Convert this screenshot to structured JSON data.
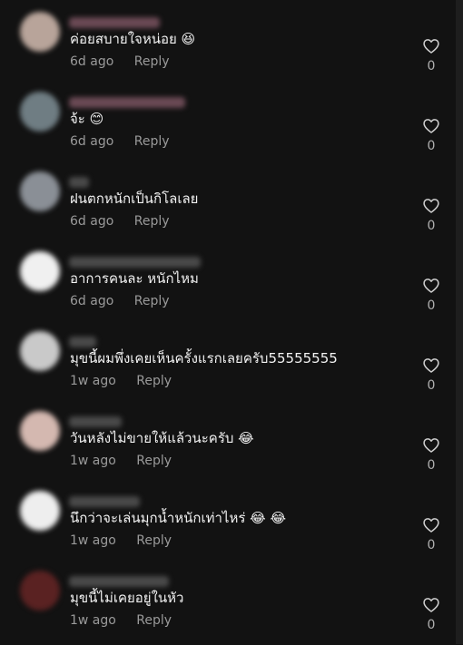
{
  "comments": [
    {
      "text": "ค่อยสบายใจหน่อย 😆",
      "time": "6d ago",
      "reply": "Reply",
      "likes": "0",
      "avatar_color": "#b8a49a",
      "username_width": 100
    },
    {
      "text": "จ้ะ 😊",
      "time": "6d ago",
      "reply": "Reply",
      "likes": "0",
      "avatar_color": "#6f7d83",
      "username_width": 128
    },
    {
      "text": "ฝนตกหนักเป็นกิโลเลย",
      "time": "6d ago",
      "reply": "Reply",
      "likes": "0",
      "avatar_color": "#8a8f96",
      "username_width": 22
    },
    {
      "text": "อาการคนละ หนักไหม",
      "time": "6d ago",
      "reply": "Reply",
      "likes": "0",
      "avatar_color": "#f0f0f0",
      "username_width": 145
    },
    {
      "text": "มุขนี้ผมพึ่งเคยเห็นครั้งแรกเลยครับ55555555",
      "time": "1w ago",
      "reply": "Reply",
      "likes": "0",
      "avatar_color": "#c9c9c9",
      "username_width": 30
    },
    {
      "text": "วันหลังไม่ขายให้แล้วนะครับ 😂",
      "time": "1w ago",
      "reply": "Reply",
      "likes": "0",
      "avatar_color": "#d4b8b0",
      "username_width": 58
    },
    {
      "text": "นึกว่าจะเล่นมุกน้ำหนักเท่าไหร่ 😂 😂",
      "time": "1w ago",
      "reply": "Reply",
      "likes": "0",
      "avatar_color": "#eeeeee",
      "username_width": 78
    },
    {
      "text": "มุขนี้ไม่เคยอยู่ในหัว",
      "time": "1w ago",
      "reply": "Reply",
      "likes": "0",
      "avatar_color": "#5a2222",
      "username_width": 110
    }
  ],
  "colors": {
    "background": "#121212",
    "meta_text": "#9a9a9a",
    "heart_accent": "#c8294a"
  },
  "icons": {
    "like": "heart-outline-icon"
  }
}
